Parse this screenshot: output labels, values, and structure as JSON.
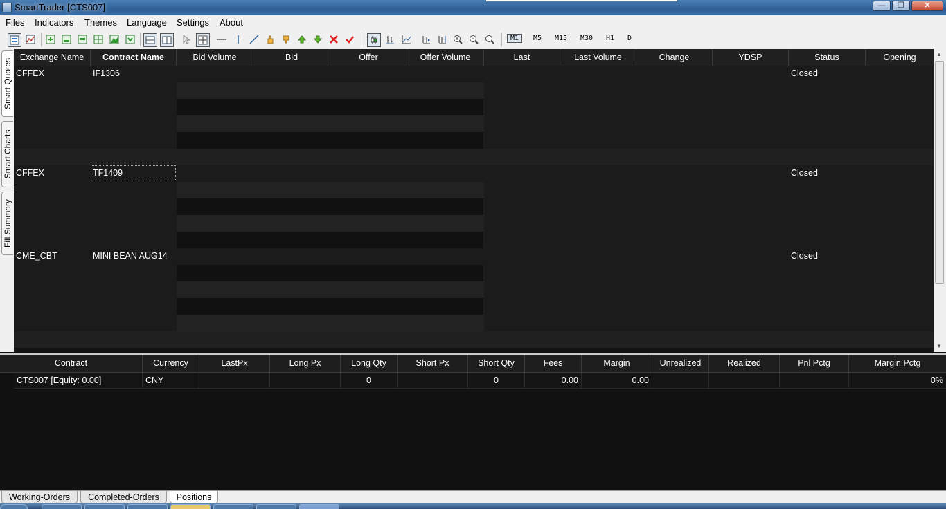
{
  "window": {
    "title": "SmartTrader [CTS007]",
    "controls": {
      "minimize": "—",
      "maximize": "❐",
      "close": "✕"
    }
  },
  "menu": [
    "Files",
    "Indicators",
    "Themes",
    "Language",
    "Settings",
    "About"
  ],
  "toolbar": {
    "timeframes": [
      "M1",
      "M5",
      "M15",
      "M30",
      "H1",
      "D"
    ],
    "selected_timeframe": "M1",
    "icons": [
      "layout-icon",
      "chart-icon",
      "add-chart-icon",
      "chart-template-icon",
      "chart-window-icon",
      "chart-grid-icon",
      "chart-area-icon",
      "chart-save-icon",
      "tile-horizontal-icon",
      "tile-vertical-icon",
      "pointer-icon",
      "crosshair-icon",
      "horizontal-line-icon",
      "vertical-line-icon",
      "trend-line-icon",
      "hand-up-icon",
      "hand-down-icon",
      "arrow-up-icon",
      "arrow-down-icon",
      "delete-icon",
      "check-icon",
      "candle-icon",
      "bar-chart-icon",
      "line-chart-icon",
      "auto-scroll-icon",
      "chart-shift-icon",
      "zoom-in-icon",
      "zoom-out-icon",
      "zoom-reset-icon"
    ]
  },
  "side_tabs": [
    "Smart Quotes",
    "Smart Charts",
    "Fill Summary"
  ],
  "quotes": {
    "columns": [
      "Exchange Name",
      "Contract Name",
      "Bid Volume",
      "Bid",
      "Offer",
      "Offer Volume",
      "Last",
      "Last Volume",
      "Change",
      "YDSP",
      "Status",
      "Opening"
    ],
    "rows": [
      {
        "exchange": "CFFEX",
        "contract": "IF1306",
        "status": "Closed"
      },
      {
        "exchange": "CFFEX",
        "contract": "TF1409",
        "status": "Closed",
        "selected": true
      },
      {
        "exchange": "CME_CBT",
        "contract": "MINI BEAN AUG14",
        "status": "Closed"
      }
    ]
  },
  "positions": {
    "columns": [
      "Contract",
      "Currency",
      "LastPx",
      "Long Px",
      "Long Qty",
      "Short Px",
      "Short Qty",
      "Fees",
      "Margin",
      "Unrealized",
      "Realized",
      "Pnl Pctg",
      "Margin Pctg"
    ],
    "row": {
      "contract": "CTS007 [Equity: 0.00]",
      "currency": "CNY",
      "last_px": "",
      "long_px": "",
      "long_qty": "0",
      "short_px": "",
      "short_qty": "0",
      "fees": "0.00",
      "margin": "0.00",
      "unrealized": "",
      "realized": "",
      "pnl_pctg": "",
      "margin_pctg": "0%"
    }
  },
  "bottom_tabs": [
    "Working-Orders",
    "Completed-Orders",
    "Positions"
  ],
  "active_bottom_tab": "Positions",
  "colors": {
    "background": "#111111",
    "header_bg": "#202020",
    "chrome": "#f0f0f0",
    "titlebar": "#3a6ea8"
  }
}
